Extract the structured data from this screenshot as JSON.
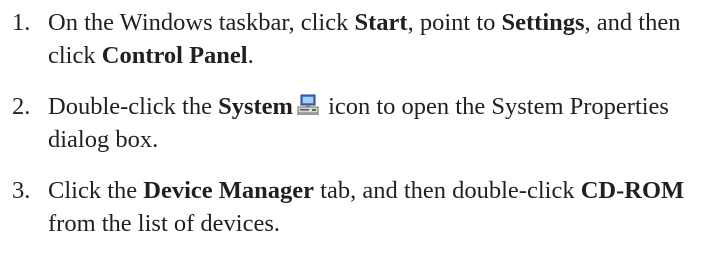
{
  "steps": [
    {
      "number": "1.",
      "p1": "On the Windows taskbar, click ",
      "b1": "Start",
      "p2": ", point to ",
      "b2": "Settings",
      "p3": ", and then click ",
      "b3": "Control Panel",
      "p4": "."
    },
    {
      "number": "2.",
      "p1": "Double-click the ",
      "b1": "System",
      "icon": "system-computer-icon",
      "p2": " icon to open the System Properties dialog box."
    },
    {
      "number": "3.",
      "p1": "Click the ",
      "b1": "Device Manager",
      "p2": " tab, and then double-click ",
      "b2": "CD-ROM",
      "p3": " from the list of devices."
    }
  ]
}
